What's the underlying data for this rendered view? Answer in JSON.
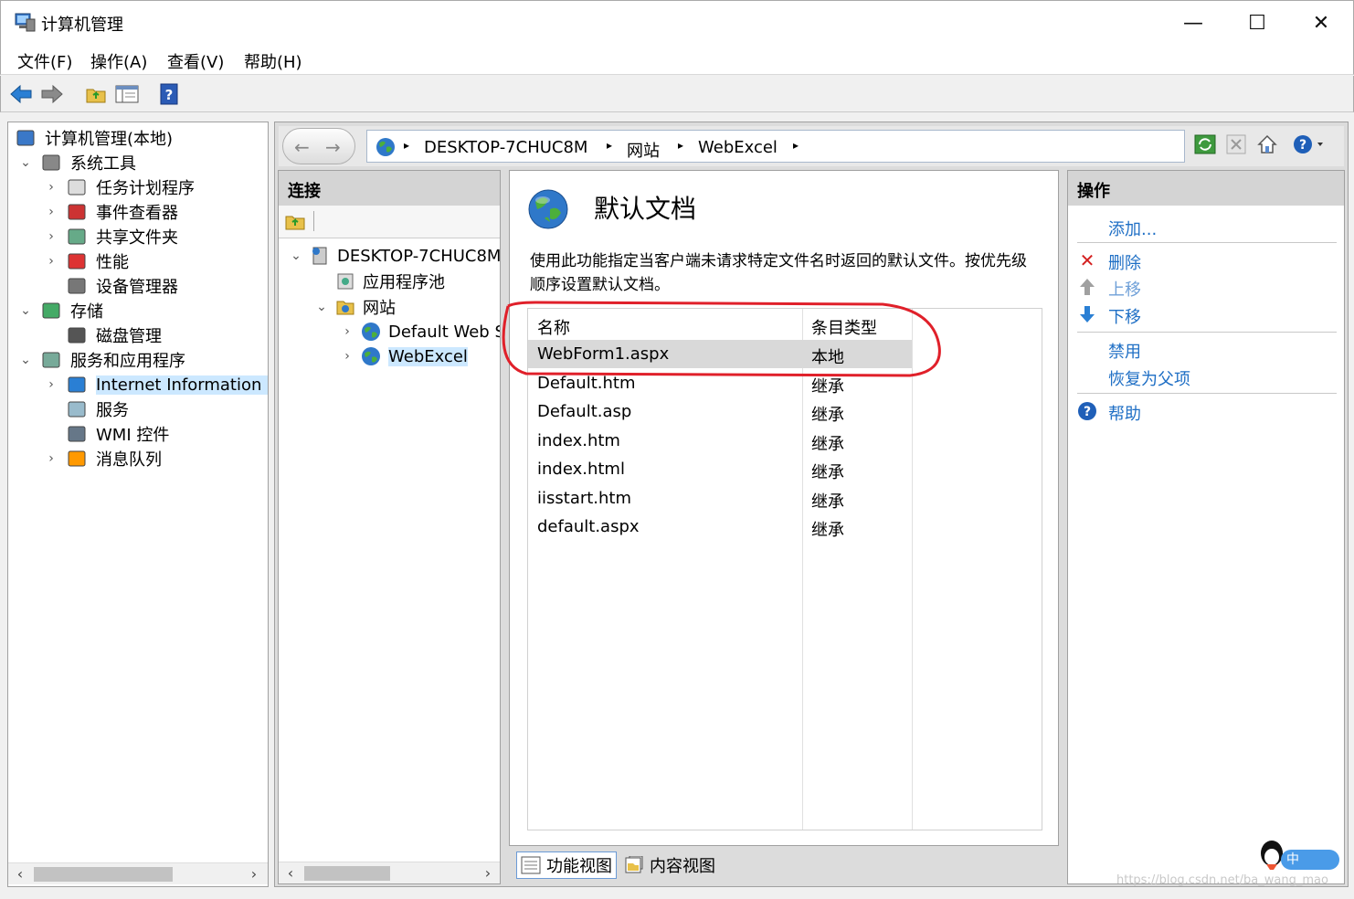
{
  "window": {
    "title": "计算机管理",
    "minimize": "—",
    "maximize": "☐",
    "close": "✕"
  },
  "menu": [
    "文件(F)",
    "操作(A)",
    "查看(V)",
    "帮助(H)"
  ],
  "left_tree": {
    "items": [
      {
        "label": "计算机管理(本地)",
        "icon": "computer-management-icon",
        "expand": ""
      },
      {
        "label": "系统工具",
        "icon": "system-tools-icon",
        "expand": "⌄"
      },
      {
        "label": "任务计划程序",
        "icon": "clock-icon",
        "expand": "›"
      },
      {
        "label": "事件查看器",
        "icon": "event-viewer-icon",
        "expand": "›"
      },
      {
        "label": "共享文件夹",
        "icon": "shared-folder-icon",
        "expand": "›"
      },
      {
        "label": "性能",
        "icon": "performance-icon",
        "expand": "›"
      },
      {
        "label": "设备管理器",
        "icon": "device-manager-icon",
        "expand": ""
      },
      {
        "label": "存储",
        "icon": "storage-icon",
        "expand": "⌄"
      },
      {
        "label": "磁盘管理",
        "icon": "disk-icon",
        "expand": ""
      },
      {
        "label": "服务和应用程序",
        "icon": "services-apps-icon",
        "expand": "⌄"
      },
      {
        "label": "Internet Information Se",
        "icon": "iis-icon",
        "expand": "›"
      },
      {
        "label": "服务",
        "icon": "services-gear-icon",
        "expand": ""
      },
      {
        "label": "WMI 控件",
        "icon": "wmi-icon",
        "expand": ""
      },
      {
        "label": "消息队列",
        "icon": "message-queue-icon",
        "expand": "›"
      }
    ]
  },
  "address": {
    "crumbs": [
      "DESKTOP-7CHUC8M",
      "网站",
      "WebExcel"
    ],
    "sep": "▸"
  },
  "connections": {
    "header": "连接",
    "tree": [
      {
        "label": "DESKTOP-7CHUC8M",
        "expand": "⌄"
      },
      {
        "label": "应用程序池",
        "expand": ""
      },
      {
        "label": "网站",
        "expand": "⌄"
      },
      {
        "label": "Default Web Site",
        "expand": "›"
      },
      {
        "label": "WebExcel",
        "expand": "›"
      }
    ]
  },
  "feature": {
    "title": "默认文档",
    "description": "使用此功能指定当客户端未请求特定文件名时返回的默认文件。按优先级顺序设置默认文档。",
    "columns": [
      "名称",
      "条目类型"
    ],
    "rows": [
      {
        "name": "WebForm1.aspx",
        "type": "本地"
      },
      {
        "name": "Default.htm",
        "type": "继承"
      },
      {
        "name": "Default.asp",
        "type": "继承"
      },
      {
        "name": "index.htm",
        "type": "继承"
      },
      {
        "name": "index.html",
        "type": "继承"
      },
      {
        "name": "iisstart.htm",
        "type": "继承"
      },
      {
        "name": "default.aspx",
        "type": "继承"
      }
    ]
  },
  "view_tabs": [
    "功能视图",
    "内容视图"
  ],
  "actions": {
    "header": "操作",
    "items": [
      "添加...",
      "删除",
      "上移",
      "下移",
      "禁用",
      "恢复为父项",
      "帮助"
    ]
  },
  "ime": {
    "text": "中"
  },
  "watermark": "https://blog.csdn.net/ba_wang_mao",
  "colors": {
    "annotation_red": "#e0202a",
    "link_blue": "#1f6fc5",
    "selection": "#cce8ff"
  }
}
